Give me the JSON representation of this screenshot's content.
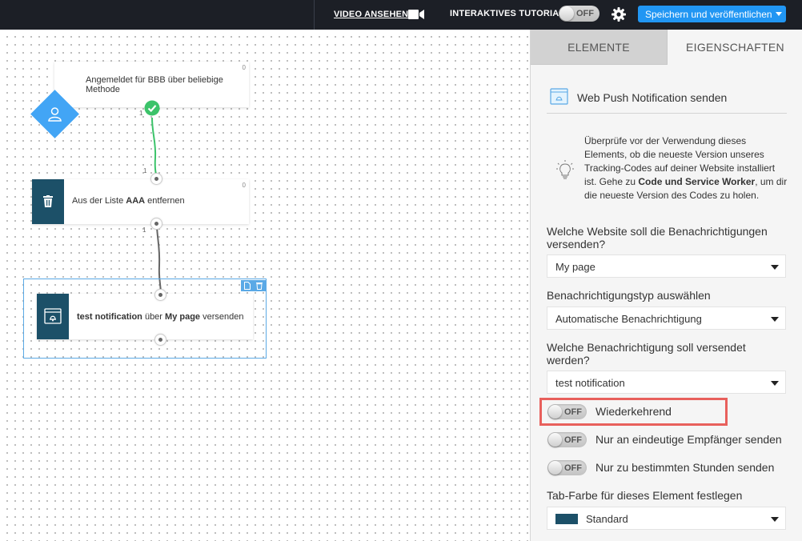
{
  "topbar": {
    "video_label": "VIDEO ANSEHEN",
    "tutorial_label": "INTERAKTIVES TUTORIAL",
    "tutorial_toggle": "OFF",
    "save_label": "Speichern und veröffentlichen",
    "icons": [
      "video-camera-icon",
      "gear-icon",
      "caret-down-icon"
    ]
  },
  "canvas": {
    "node1": {
      "text": "Angemeldet für BBB über beliebige Methode",
      "count": "0",
      "out_label": "1",
      "icon": "user-icon",
      "status_icon": "check-icon"
    },
    "node2": {
      "text_pre": "Aus der Liste ",
      "text_bold": "AAA",
      "text_post": " entfernen",
      "count": "0",
      "in_label": "1",
      "out_label": "1",
      "icon": "trash-icon"
    },
    "node3": {
      "text_bold1": "test notification",
      "text_mid": " über ",
      "text_bold2": "My page",
      "text_post": " versenden",
      "icon": "browser-bell-icon",
      "tools": [
        "copy-icon",
        "trash-icon"
      ]
    },
    "colors": {
      "link_green": "#3cc36a",
      "link_gray": "#666666",
      "node_side": "#1c5068",
      "trigger": "#42a5f5",
      "selection": "#5aa9e6"
    }
  },
  "panel": {
    "tabs": [
      "ELEMENTE",
      "EIGENSCHAFTEN"
    ],
    "active_tab": "EIGENSCHAFTEN",
    "title": "Web Push Notification senden",
    "info_pre": "Überprüfe vor der Verwendung dieses Elements, ob die neueste Version unseres Tracking-Codes auf deiner Website installiert ist. Gehe zu ",
    "info_bold": "Code und Service Worker",
    "info_post": ", um dir die neueste Version des Codes zu holen.",
    "website_label": "Welche Website soll die Benachrichtigungen versenden?",
    "website_value": "My page",
    "type_label": "Benachrichtigungstyp auswählen",
    "type_value": "Automatische Benachrichtigung",
    "notification_label": "Welche Benachrichtigung soll versendet werden?",
    "notification_value": "test notification",
    "toggles": [
      {
        "label": "Wiederkehrend",
        "state": "OFF"
      },
      {
        "label": "Nur an eindeutige Empfänger senden",
        "state": "OFF"
      },
      {
        "label": "Nur zu bestimmten Stunden senden",
        "state": "OFF"
      }
    ],
    "tabcolor_label": "Tab-Farbe für dieses Element festlegen",
    "tabcolor_value": "Standard",
    "tabcolor_swatch": "#1c5068",
    "highlight_color": "#e8605c"
  }
}
